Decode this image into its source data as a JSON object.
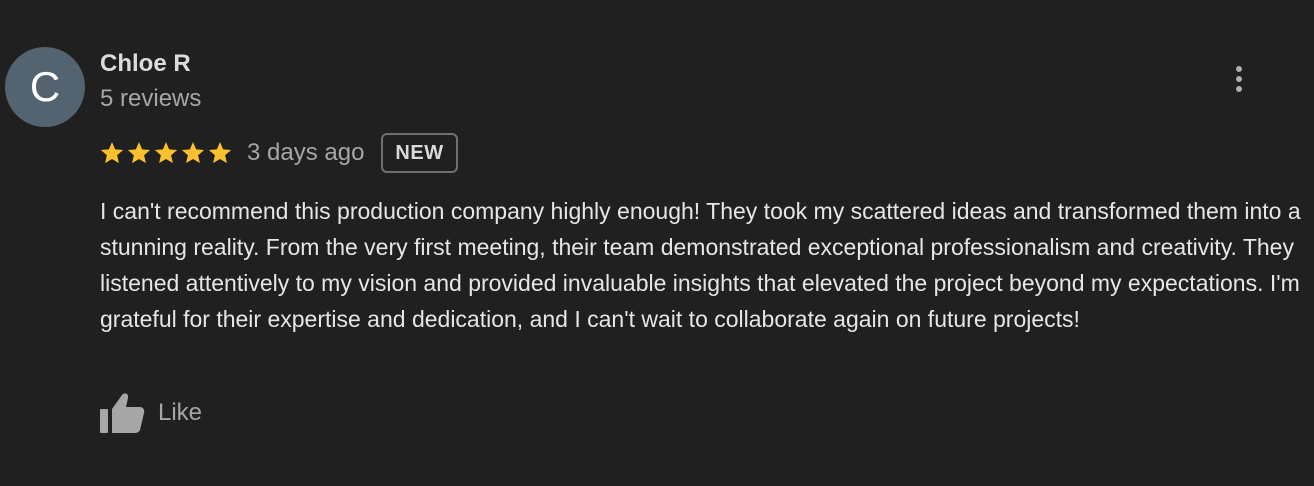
{
  "review": {
    "avatar_initial": "C",
    "avatar_color": "#536470",
    "reviewer_name": "Chloe R",
    "review_count": "5 reviews",
    "rating": 5,
    "rating_max": 5,
    "star_color": "#fbc02d",
    "time_ago": "3 days ago",
    "badge": "NEW",
    "text": "I can't recommend this production company highly enough! They took my scattered ideas and transformed them into a stunning reality. From the very first meeting, their team demonstrated exceptional professionalism and creativity. They listened attentively to my vision and provided invaluable insights that elevated the project beyond my expectations. I'm grateful for their expertise and dedication, and I can't wait to collaborate again on future projects!",
    "like_label": "Like",
    "icons": {
      "more": "more-vertical-icon",
      "like": "thumbs-up-icon",
      "star": "star-icon"
    }
  }
}
